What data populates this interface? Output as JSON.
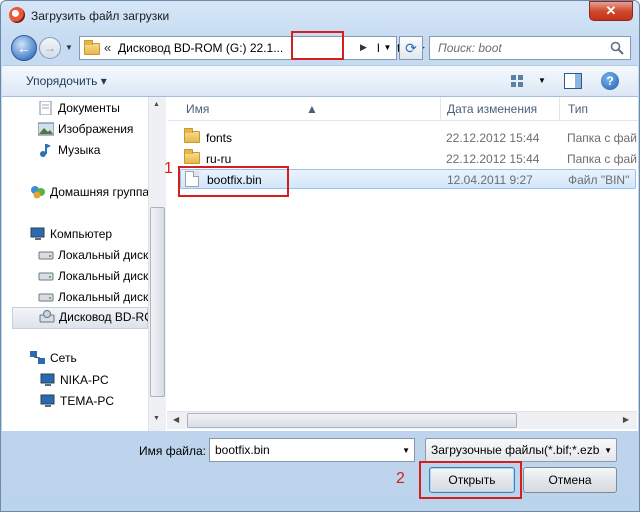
{
  "window": {
    "title": "Загрузить файл загрузки",
    "close_label": "✕"
  },
  "address": {
    "prefix": "«",
    "crumbs": [
      "Дисковод BD-ROM (G:) 22.1...",
      "boot"
    ]
  },
  "search": {
    "placeholder": "Поиск: boot"
  },
  "toolbar": {
    "organize_label": "Упорядочить ▾",
    "help_label": "?"
  },
  "nav": {
    "items": [
      {
        "label": "Документы",
        "icon": "documents-icon"
      },
      {
        "label": "Изображения",
        "icon": "pictures-icon"
      },
      {
        "label": "Музыка",
        "icon": "music-icon"
      },
      {
        "label": "Домашняя группа",
        "icon": "homegroup-icon"
      },
      {
        "label": "Компьютер",
        "icon": "computer-icon"
      },
      {
        "label": "Локальный диск",
        "icon": "drive-icon"
      },
      {
        "label": "Локальный диск",
        "icon": "drive-icon"
      },
      {
        "label": "Локальный диск",
        "icon": "drive-icon"
      },
      {
        "label": "Дисковод BD-RO",
        "icon": "bd-drive-icon"
      },
      {
        "label": "Сеть",
        "icon": "network-icon"
      },
      {
        "label": "NIKA-PC",
        "icon": "pc-icon"
      },
      {
        "label": "TEMA-PC",
        "icon": "pc-icon"
      }
    ]
  },
  "files": {
    "columns": [
      "Имя",
      "Дата изменения",
      "Тип"
    ],
    "rows": [
      {
        "name": "fonts",
        "date": "22.12.2012 15:44",
        "type": "Папка с фай",
        "icon": "folder-icon"
      },
      {
        "name": "ru-ru",
        "date": "22.12.2012 15:44",
        "type": "Папка с фай",
        "icon": "folder-icon"
      },
      {
        "name": "bootfix.bin",
        "date": "12.04.2011 9:27",
        "type": "Файл \"BIN\"",
        "icon": "file-icon"
      }
    ]
  },
  "bottom": {
    "filename_label": "Имя файла:",
    "filename_value": "bootfix.bin",
    "filetype_value": "Загрузочные файлы(*.bif;*.ezb",
    "open_label": "Открыть",
    "cancel_label": "Отмена"
  },
  "annotations": {
    "marker_1": "1",
    "marker_2": "2"
  },
  "colors": {
    "highlight": "#d41f1f",
    "selection": "#d3e6fb"
  }
}
